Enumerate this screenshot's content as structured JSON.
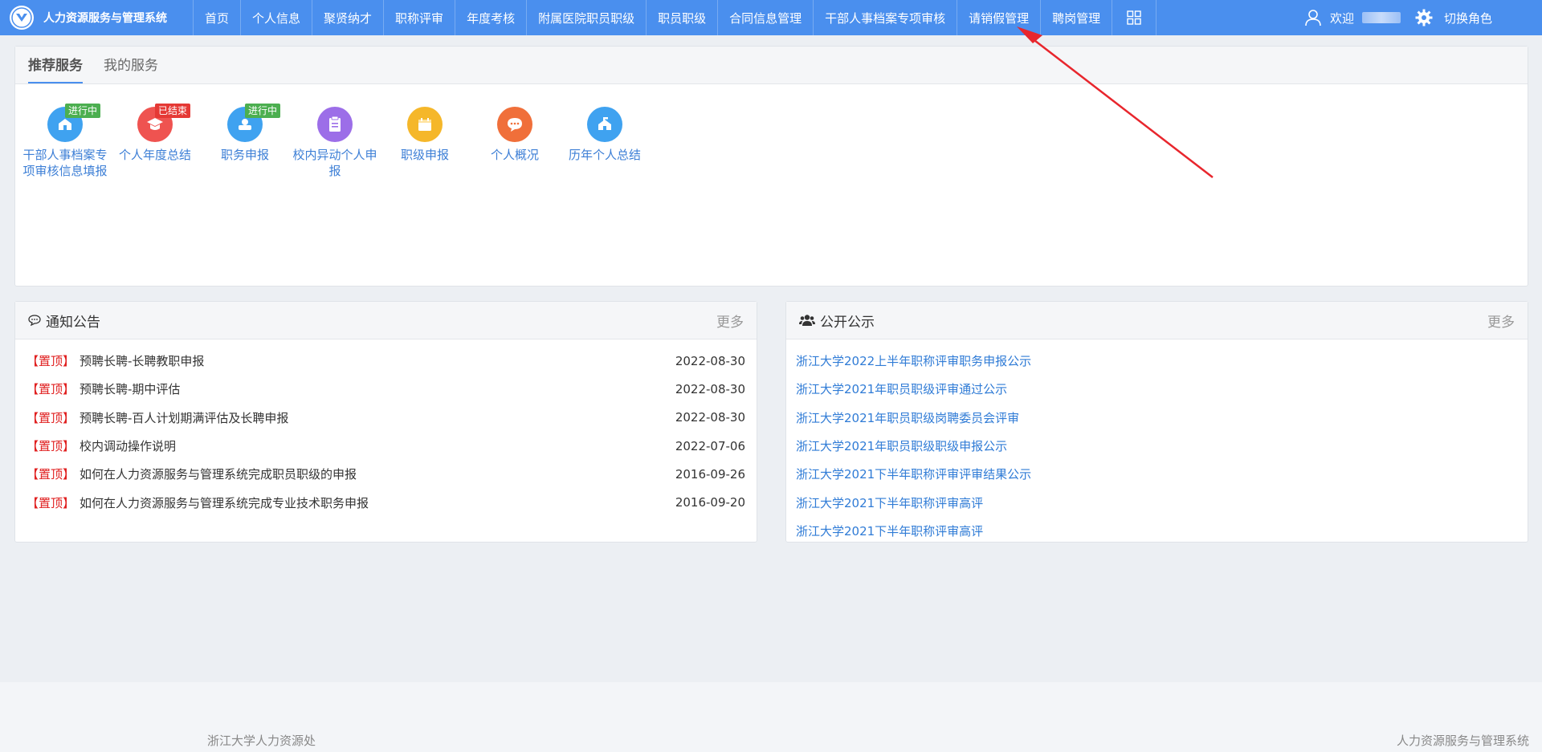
{
  "header": {
    "title": "人力资源服务与管理系统",
    "welcome_label": "欢迎",
    "switch_role_label": "切换角色"
  },
  "nav": [
    {
      "label": "首页"
    },
    {
      "label": "个人信息"
    },
    {
      "label": "聚贤纳才"
    },
    {
      "label": "职称评审"
    },
    {
      "label": "年度考核"
    },
    {
      "label": "附属医院职员职级"
    },
    {
      "label": "职员职级"
    },
    {
      "label": "合同信息管理"
    },
    {
      "label": "干部人事档案专项审核"
    },
    {
      "label": "请销假管理"
    },
    {
      "label": "聘岗管理"
    }
  ],
  "services": {
    "tabs": [
      "推荐服务",
      "我的服务"
    ],
    "items": [
      {
        "label": "干部人事档案专项审核信息填报",
        "badge": "进行中",
        "badge_color": "#4caf50",
        "color": "#3fa2f0",
        "icon": "archive-icon"
      },
      {
        "label": "个人年度总结",
        "badge": "已结束",
        "badge_color": "#e53935",
        "color": "#ef5350",
        "icon": "graduation-icon"
      },
      {
        "label": "职务申报",
        "badge": "进行中",
        "badge_color": "#4caf50",
        "color": "#3fa2f0",
        "icon": "hand-icon"
      },
      {
        "label": "校内异动个人申报",
        "badge": "",
        "badge_color": "",
        "color": "#9c6ee8",
        "icon": "clipboard-icon"
      },
      {
        "label": "职级申报",
        "badge": "",
        "badge_color": "",
        "color": "#f5b72a",
        "icon": "calendar-icon"
      },
      {
        "label": "个人概况",
        "badge": "",
        "badge_color": "",
        "color": "#f06f3a",
        "icon": "chat-icon"
      },
      {
        "label": "历年个人总结",
        "badge": "",
        "badge_color": "",
        "color": "#3fa2f0",
        "icon": "building-icon"
      }
    ]
  },
  "notice": {
    "title": "通知公告",
    "more": "更多",
    "items": [
      {
        "tag": "【置顶】",
        "text": "预聘长聘-长聘教职申报",
        "date": "2022-08-30"
      },
      {
        "tag": "【置顶】",
        "text": "预聘长聘-期中评估",
        "date": "2022-08-30"
      },
      {
        "tag": "【置顶】",
        "text": "预聘长聘-百人计划期满评估及长聘申报",
        "date": "2022-08-30"
      },
      {
        "tag": "【置顶】",
        "text": "校内调动操作说明",
        "date": "2022-07-06"
      },
      {
        "tag": "【置顶】",
        "text": "如何在人力资源服务与管理系统完成职员职级的申报",
        "date": "2016-09-26"
      },
      {
        "tag": "【置顶】",
        "text": "如何在人力资源服务与管理系统完成专业技术职务申报",
        "date": "2016-09-20"
      }
    ]
  },
  "public": {
    "title": "公开公示",
    "more": "更多",
    "items": [
      "浙江大学2022上半年职称评审职务申报公示",
      "浙江大学2021年职员职级评审通过公示",
      "浙江大学2021年职员职级岗聘委员会评审",
      "浙江大学2021年职员职级职级申报公示",
      "浙江大学2021下半年职称评审评审结果公示",
      "浙江大学2021下半年职称评审高评",
      "浙江大学2021下半年职称评审高评"
    ]
  },
  "footer": {
    "left": "浙江大学人力资源处",
    "right": "人力资源服务与管理系统"
  },
  "colors": {
    "primary": "#4a8fee",
    "link": "#2f7bd6",
    "pin_tag": "#e02020",
    "annotation_arrow": "#e8262d"
  }
}
